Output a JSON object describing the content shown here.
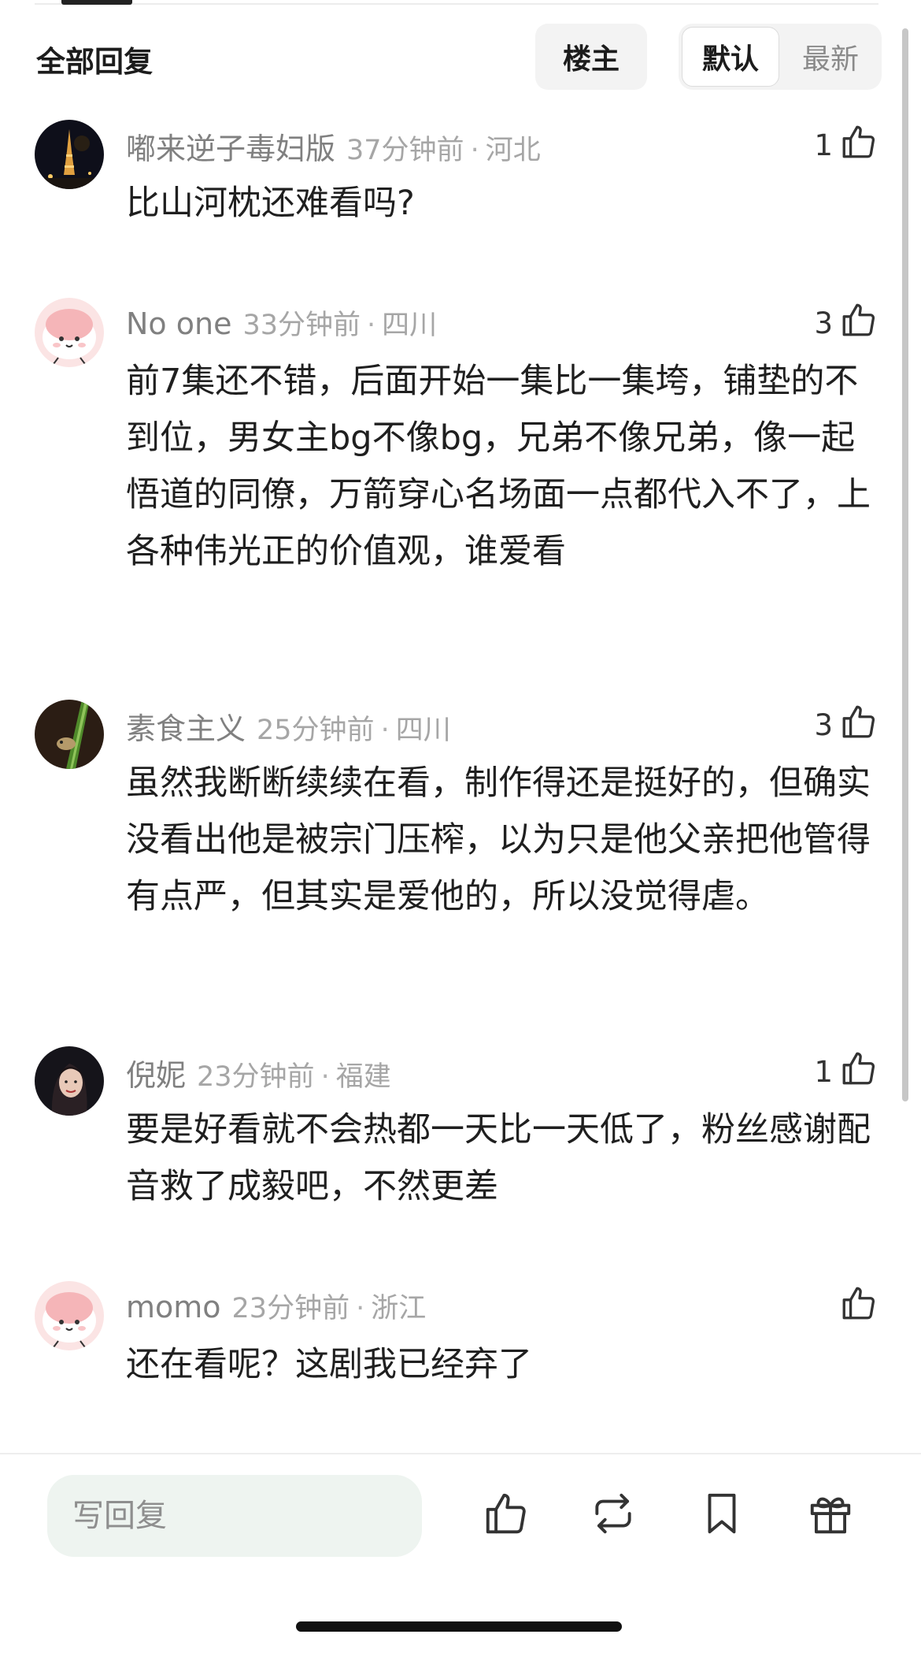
{
  "header": {
    "title": "全部回复",
    "owner_filter": "楼主",
    "sort_default": "默认",
    "sort_newest": "最新"
  },
  "comments": [
    {
      "username": "嘟来逆子毒妇版",
      "time": "37分钟前",
      "sep": "·",
      "location": "河北",
      "likes": "1",
      "text": "比山河枕还难看吗?"
    },
    {
      "username": "No one",
      "time": "33分钟前",
      "sep": "·",
      "location": "四川",
      "likes": "3",
      "text": "前7集还不错，后面开始一集比一集垮，铺垫的不到位，男女主bg不像bg，兄弟不像兄弟，像一起悟道的同僚，万箭穿心名场面一点都代入不了，上各种伟光正的价值观，谁爱看"
    },
    {
      "username": "素食主义",
      "time": "25分钟前",
      "sep": "·",
      "location": "四川",
      "likes": "3",
      "text": "虽然我断断续续在看，制作得还是挺好的，但确实没看出他是被宗门压榨，以为只是他父亲把他管得有点严，但其实是爱他的，所以没觉得虐。"
    },
    {
      "username": "倪妮",
      "time": "23分钟前",
      "sep": "·",
      "location": "福建",
      "likes": "1",
      "text": "要是好看就不会热都一天比一天低了，粉丝感谢配音救了成毅吧，不然更差"
    },
    {
      "username": "momo",
      "time": "23分钟前",
      "sep": "·",
      "location": "浙江",
      "likes": "",
      "text": "还在看呢？这剧我已经弃了"
    }
  ],
  "bottom_bar": {
    "reply_placeholder": "写回复",
    "icons": [
      "like-icon",
      "repost-icon",
      "bookmark-icon",
      "gift-icon"
    ]
  },
  "colors": {
    "accent_text": "#1f1f1f",
    "meta_gray": "#a6a6a6",
    "input_bg": "#eef4f0"
  }
}
